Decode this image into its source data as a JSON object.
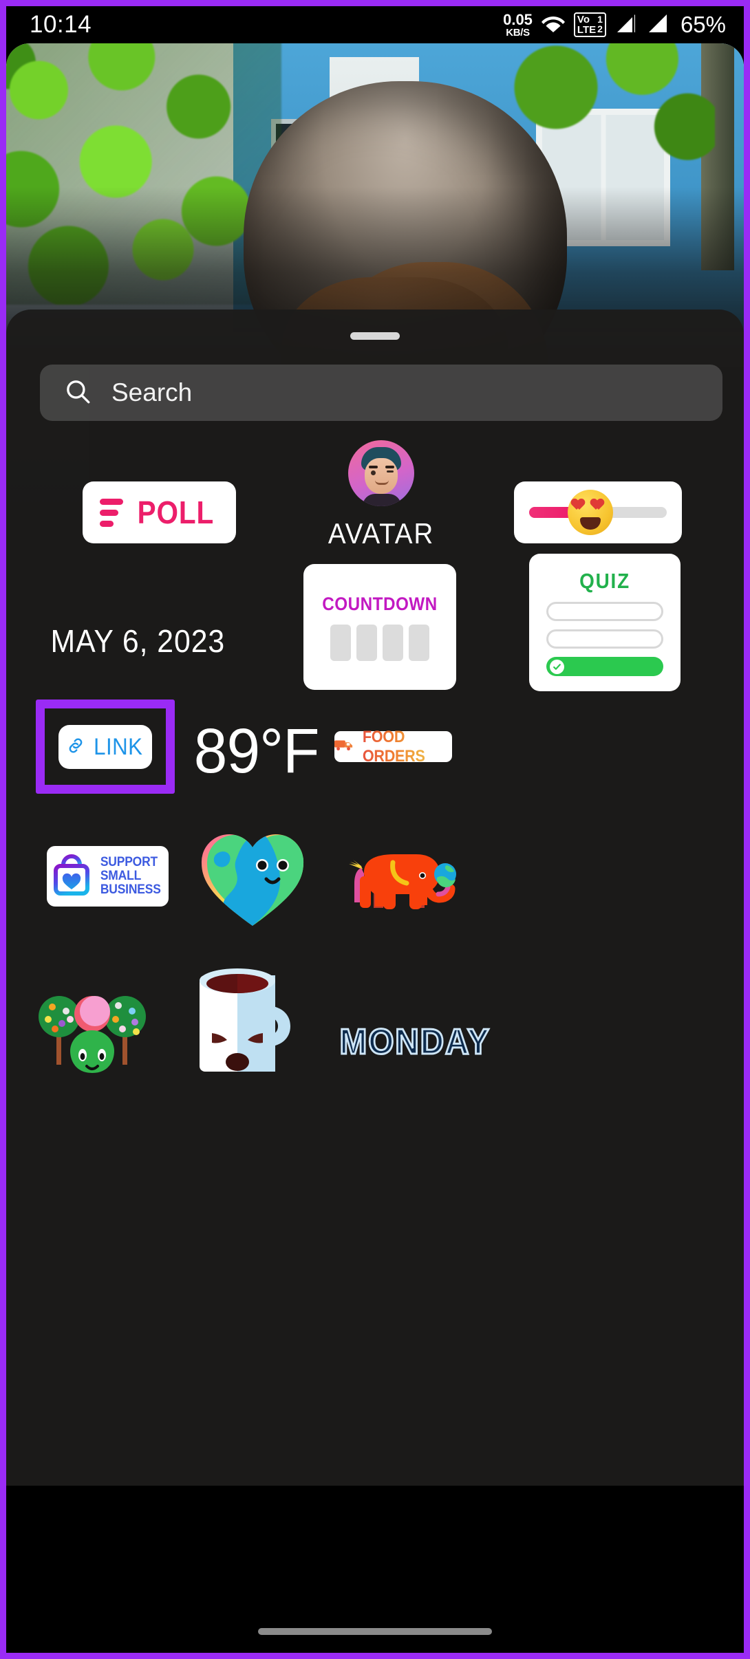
{
  "status_bar": {
    "clock": "10:14",
    "net_speed_value": "0.05",
    "net_speed_unit": "KB/S",
    "wifi_icon": "wifi-icon",
    "volte_primary": "Vo",
    "volte_secondary": "LTE",
    "sim1_label": "1",
    "sim2_label": "2",
    "signal1_icon": "signal-bars-icon",
    "signal2_icon": "signal-bars-icon",
    "battery": "65%"
  },
  "sheet": {
    "grabber": "drag-handle",
    "search": {
      "icon": "search-icon",
      "placeholder": "Search",
      "value": ""
    }
  },
  "stickers": {
    "poll": {
      "label": "POLL",
      "icon": "poll-bars-icon",
      "color": "#ec1e6a"
    },
    "avatar": {
      "label": "AVATAR",
      "icon": "avatar-memoji-icon"
    },
    "emoji_slider": {
      "icon": "heart-eyes-emoji-icon",
      "fill_color": "#ea1262",
      "track_color": "#dcdcdc",
      "fill_percent": 49
    },
    "date": {
      "label": "MAY 6, 2023"
    },
    "countdown": {
      "label": "COUNTDOWN",
      "color": "#c219c2",
      "digit_boxes": 4
    },
    "quiz": {
      "label": "QUIZ",
      "color": "#22b14c",
      "options": 3,
      "correct_option_index": 2
    },
    "link": {
      "label": "LINK",
      "icon": "chain-link-icon",
      "color": "#1e94e8",
      "highlighted": true,
      "highlight_color": "#9A2BF5"
    },
    "temperature": {
      "label": "89°F"
    },
    "food_orders": {
      "label": "FOOD ORDERS",
      "icon": "delivery-truck-icon"
    },
    "support_small_business": {
      "line1": "SUPPORT",
      "line2": "SMALL",
      "line3": "BUSINESS",
      "icon": "shopping-bag-heart-icon",
      "color": "#3c5ae0"
    },
    "earth_heart": {
      "icon": "earth-heart-sticker"
    },
    "elephant": {
      "icon": "elephant-globe-sticker"
    },
    "trees": {
      "icon": "trees-bush-sticker"
    },
    "coffee_mug": {
      "icon": "coffee-mug-sticker"
    },
    "monday": {
      "label": "MONDAY"
    }
  },
  "bottom": {
    "gesture_bar": "home-gesture-bar"
  }
}
